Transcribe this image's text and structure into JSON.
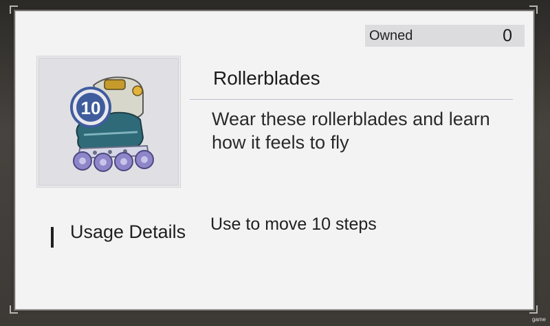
{
  "owned": {
    "label": "Owned",
    "value": "0"
  },
  "item": {
    "name": "Rollerblades",
    "badge": "10",
    "description": "Wear these rollerblades and learn how it feels to fly",
    "icon": "rollerblade-icon"
  },
  "usage": {
    "label": "Usage Details",
    "text": "Use to move 10 steps"
  },
  "corner_tag": "game",
  "colors": {
    "panel": "#f3f3f4",
    "owned_box": "#dcdcdf",
    "divider": "#b9bccc",
    "wheel": "#8e86c9",
    "boot": "#2f6a78",
    "badge": "#3f5c9d"
  }
}
